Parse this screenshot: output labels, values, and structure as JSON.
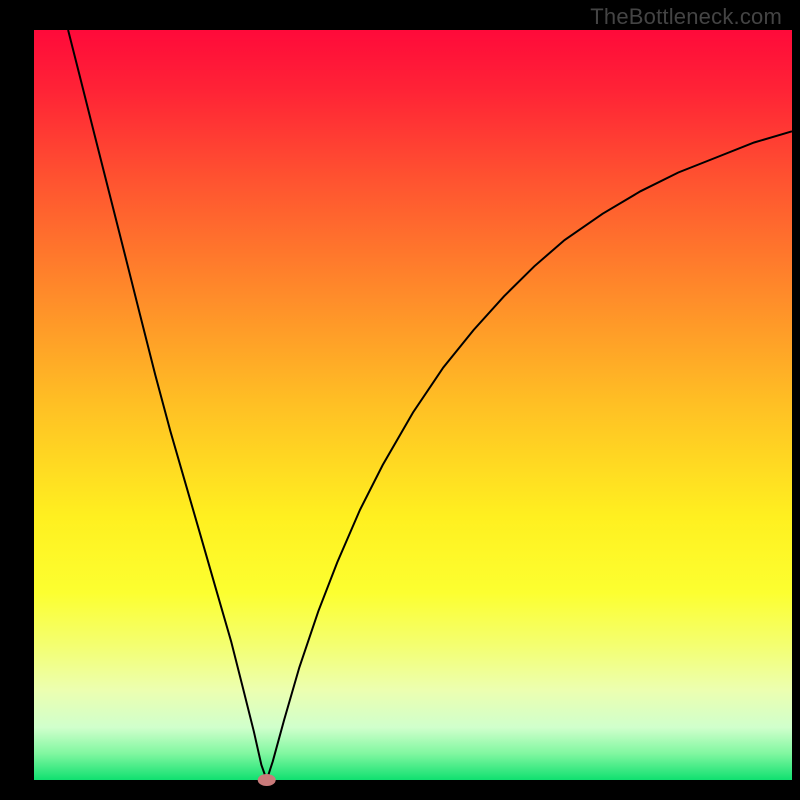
{
  "watermark": "TheBottleneck.com",
  "chart_data": {
    "type": "line",
    "title": "",
    "xlabel": "",
    "ylabel": "",
    "xlim": [
      0,
      100
    ],
    "ylim": [
      0,
      100
    ],
    "marker": {
      "x": 30.7,
      "y": 0,
      "color": "#c97a7a",
      "rx": 9,
      "ry": 6
    },
    "background_gradient": {
      "stops": [
        {
          "offset": 0.0,
          "color": "#ff0a3a"
        },
        {
          "offset": 0.08,
          "color": "#ff2336"
        },
        {
          "offset": 0.2,
          "color": "#ff5330"
        },
        {
          "offset": 0.35,
          "color": "#ff8a2a"
        },
        {
          "offset": 0.5,
          "color": "#ffc024"
        },
        {
          "offset": 0.65,
          "color": "#fff020"
        },
        {
          "offset": 0.75,
          "color": "#fcff30"
        },
        {
          "offset": 0.82,
          "color": "#f4ff70"
        },
        {
          "offset": 0.88,
          "color": "#ecffb0"
        },
        {
          "offset": 0.93,
          "color": "#d0ffcc"
        },
        {
          "offset": 0.965,
          "color": "#80f7a0"
        },
        {
          "offset": 1.0,
          "color": "#10e070"
        }
      ]
    },
    "series": [
      {
        "name": "bottleneck-curve",
        "color": "#000000",
        "width": 2.0,
        "points": [
          {
            "x": 4.5,
            "y": 100.0
          },
          {
            "x": 6.0,
            "y": 94.0
          },
          {
            "x": 8.0,
            "y": 86.0
          },
          {
            "x": 10.0,
            "y": 78.0
          },
          {
            "x": 12.0,
            "y": 70.0
          },
          {
            "x": 14.0,
            "y": 62.0
          },
          {
            "x": 16.0,
            "y": 54.0
          },
          {
            "x": 18.0,
            "y": 46.5
          },
          {
            "x": 20.0,
            "y": 39.5
          },
          {
            "x": 22.0,
            "y": 32.5
          },
          {
            "x": 24.0,
            "y": 25.5
          },
          {
            "x": 26.0,
            "y": 18.5
          },
          {
            "x": 27.5,
            "y": 12.5
          },
          {
            "x": 29.0,
            "y": 6.5
          },
          {
            "x": 30.0,
            "y": 2.0
          },
          {
            "x": 30.7,
            "y": 0.0
          },
          {
            "x": 31.5,
            "y": 2.5
          },
          {
            "x": 33.0,
            "y": 8.0
          },
          {
            "x": 35.0,
            "y": 15.0
          },
          {
            "x": 37.5,
            "y": 22.5
          },
          {
            "x": 40.0,
            "y": 29.0
          },
          {
            "x": 43.0,
            "y": 36.0
          },
          {
            "x": 46.0,
            "y": 42.0
          },
          {
            "x": 50.0,
            "y": 49.0
          },
          {
            "x": 54.0,
            "y": 55.0
          },
          {
            "x": 58.0,
            "y": 60.0
          },
          {
            "x": 62.0,
            "y": 64.5
          },
          {
            "x": 66.0,
            "y": 68.5
          },
          {
            "x": 70.0,
            "y": 72.0
          },
          {
            "x": 75.0,
            "y": 75.5
          },
          {
            "x": 80.0,
            "y": 78.5
          },
          {
            "x": 85.0,
            "y": 81.0
          },
          {
            "x": 90.0,
            "y": 83.0
          },
          {
            "x": 95.0,
            "y": 85.0
          },
          {
            "x": 100.0,
            "y": 86.5
          }
        ]
      }
    ]
  }
}
